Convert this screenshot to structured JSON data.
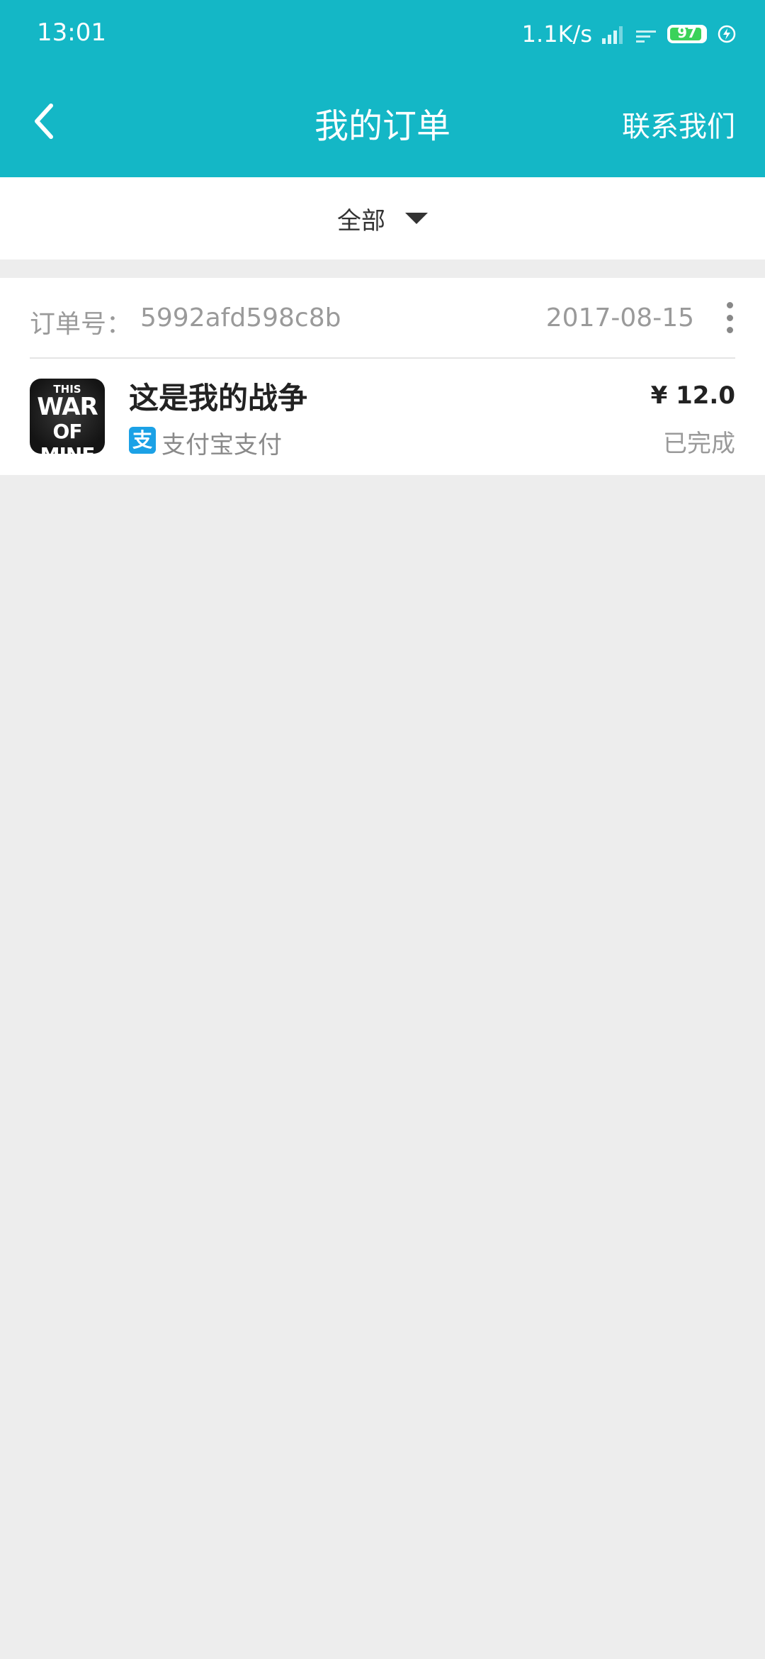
{
  "status_bar": {
    "time": "13:01",
    "net_speed": "1.1K/s",
    "battery_level": "97",
    "icons": [
      "signal-icon",
      "wifi-icon",
      "battery-icon",
      "charging-icon"
    ]
  },
  "header": {
    "back_icon": "chevron-left-icon",
    "title": "我的订单",
    "contact_label": "联系我们",
    "background_color": "#14b7c6"
  },
  "filter": {
    "selected": "全部",
    "dropdown_icon": "caret-down-icon"
  },
  "orders": [
    {
      "order_number_label": "订单号：",
      "order_number": "5992afd598c8b",
      "date": "2017-08-15",
      "more_icon": "more-vertical-icon",
      "product_name": "这是我的战争",
      "product_icon_text": {
        "line1": "THIS",
        "line2": "WAR",
        "line3": "OF MINE"
      },
      "payment_icon": "alipay-icon",
      "payment_icon_glyph": "支",
      "payment_method": "支付宝支付",
      "price": "¥ 12.0",
      "status": "已完成"
    }
  ]
}
